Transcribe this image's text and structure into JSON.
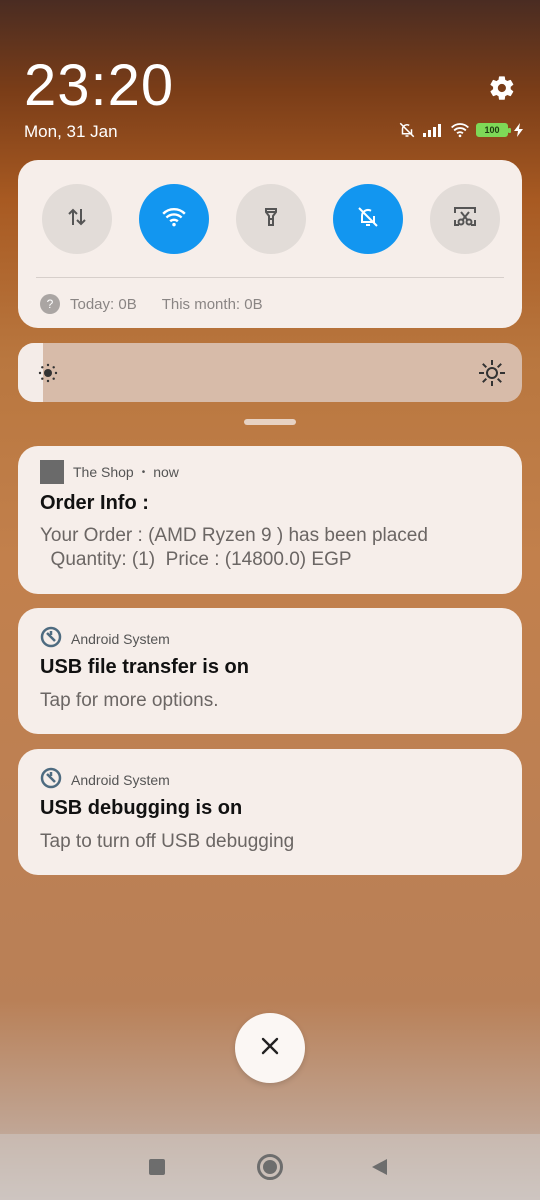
{
  "status_bar": {
    "time": "23:20",
    "date": "Mon, 31 Jan",
    "battery_level": "100",
    "icons": [
      "silent-bell-icon",
      "signal-icon",
      "wifi-icon",
      "battery-icon",
      "charging-bolt-icon"
    ]
  },
  "quick_settings": {
    "tiles": [
      {
        "name": "mobile-data",
        "icon": "data-arrows-icon",
        "active": false
      },
      {
        "name": "wifi",
        "icon": "wifi-icon",
        "active": true
      },
      {
        "name": "flashlight",
        "icon": "flashlight-icon",
        "active": false
      },
      {
        "name": "silent",
        "icon": "bell-off-icon",
        "active": true
      },
      {
        "name": "screenshot",
        "icon": "scissors-screenshot-icon",
        "active": false
      }
    ],
    "usage_today": "Today: 0B",
    "usage_month": "This month: 0B",
    "active_color": "#1296f0"
  },
  "brightness": {
    "level_fraction": 0.05
  },
  "notifications": [
    {
      "app": "The Shop",
      "time": "now",
      "title": "Order Info :",
      "body": "Your Order : (AMD Ryzen 9 ) has been placed\n  Quantity: (1)  Price : (14800.0) EGP"
    },
    {
      "app": "Android System",
      "title": "USB file transfer is on",
      "body": "Tap for more options."
    },
    {
      "app": "Android System",
      "title": "USB debugging is on",
      "body": "Tap to turn off USB debugging"
    }
  ],
  "nav": {
    "buttons": [
      "recents-square-icon",
      "home-circle-icon",
      "back-triangle-icon"
    ]
  }
}
